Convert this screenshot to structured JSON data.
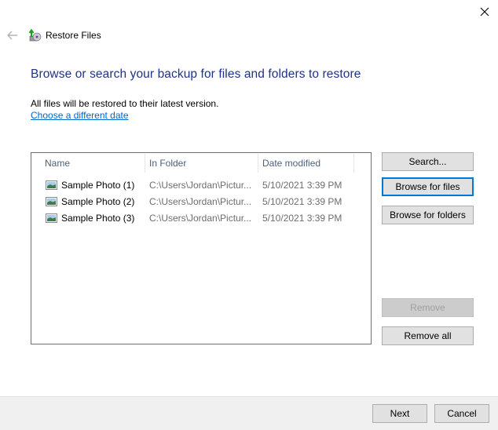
{
  "window": {
    "title": "Restore Files",
    "close_icon": "close-icon",
    "back_icon": "back-arrow-icon",
    "app_icon": "restore-files-icon"
  },
  "main": {
    "heading": "Browse or search your backup for files and folders to restore",
    "info_text": "All files will be restored to their latest version.",
    "date_link": "Choose a different date"
  },
  "file_list": {
    "columns": [
      "Name",
      "In Folder",
      "Date modified"
    ],
    "rows": [
      {
        "name": "Sample Photo (1)",
        "folder": "C:\\Users\\Jordan\\Pictur...",
        "date": "5/10/2021 3:39 PM",
        "icon": "image-file-icon"
      },
      {
        "name": "Sample Photo (2)",
        "folder": "C:\\Users\\Jordan\\Pictur...",
        "date": "5/10/2021 3:39 PM",
        "icon": "image-file-icon"
      },
      {
        "name": "Sample Photo (3)",
        "folder": "C:\\Users\\Jordan\\Pictur...",
        "date": "5/10/2021 3:39 PM",
        "icon": "image-file-icon"
      }
    ]
  },
  "side_buttons": {
    "search": "Search...",
    "browse_files": "Browse for files",
    "browse_folders": "Browse for folders",
    "remove": "Remove",
    "remove_all": "Remove all"
  },
  "footer": {
    "next": "Next",
    "cancel": "Cancel"
  },
  "colors": {
    "heading": "#1e3287",
    "link": "#0066cc",
    "focus": "#0078d7"
  }
}
